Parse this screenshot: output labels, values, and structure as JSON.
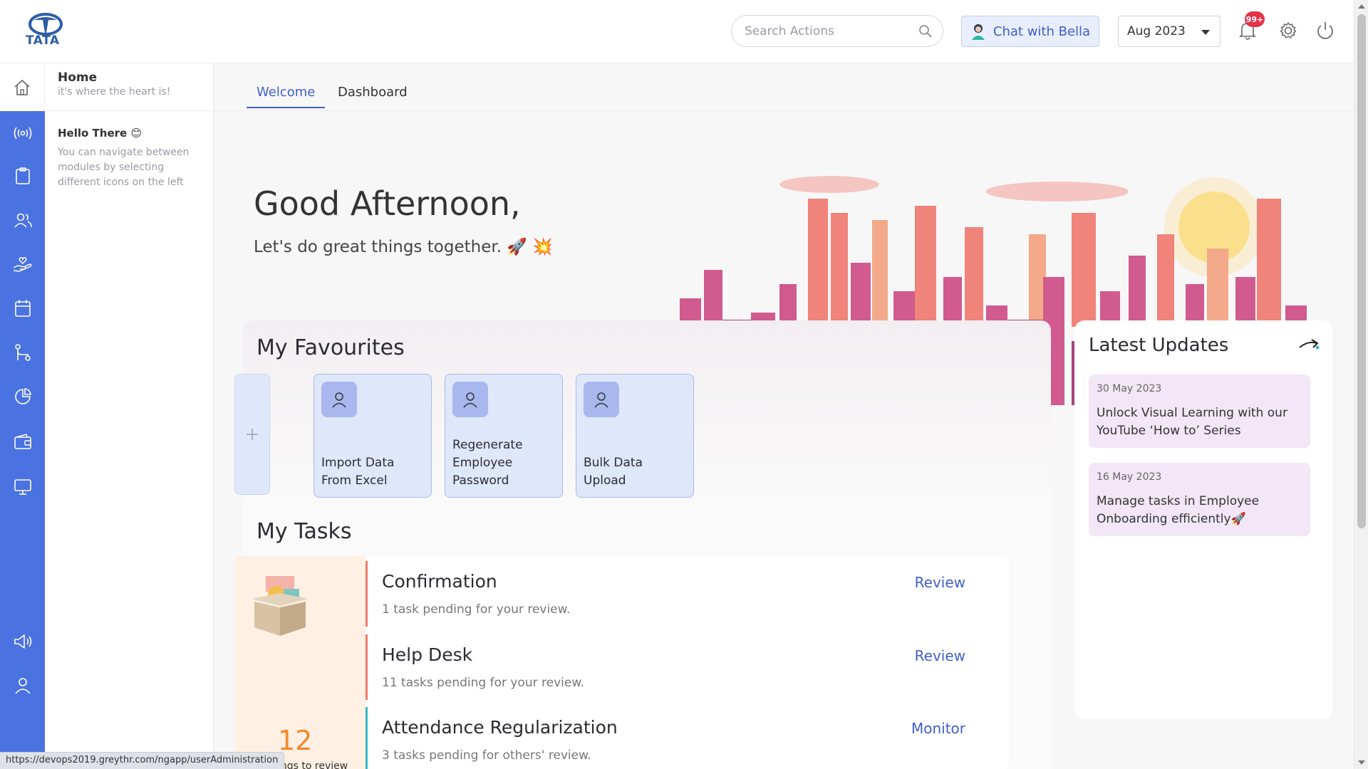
{
  "brand": {
    "logo_text": "TATA"
  },
  "header": {
    "search_placeholder": "Search Actions",
    "chat_label": "Chat with Bella",
    "month": "Aug 2023",
    "notification_badge": "99+"
  },
  "rail": {
    "icons": [
      "home-icon",
      "broadcast-icon",
      "clipboard-icon",
      "people-icon",
      "hand-heart-icon",
      "calendar-icon",
      "workflow-icon",
      "pie-chart-icon",
      "wallet-icon",
      "monitor-icon",
      "megaphone-icon",
      "user-icon"
    ]
  },
  "subnav": {
    "title": "Home",
    "subtitle": "it's where the heart is!",
    "hello": "Hello There",
    "hello_emoji": "😊",
    "description": "You can navigate between modules by selecting different icons on the left"
  },
  "tabs": [
    {
      "label": "Welcome",
      "active": true
    },
    {
      "label": "Dashboard",
      "active": false
    }
  ],
  "welcome": {
    "greeting": "Good Afternoon,",
    "tagline": "Let's do great things together. 🚀 💥"
  },
  "favourites": {
    "title": "My Favourites",
    "items": [
      {
        "label": "Import Data From Excel"
      },
      {
        "label": "Regenerate Employee Password"
      },
      {
        "label": "Bulk Data Upload"
      }
    ]
  },
  "tasks": {
    "title": "My Tasks",
    "count": "12",
    "count_label": "ings to review",
    "items": [
      {
        "title": "Confirmation",
        "desc": "1 task pending for your review.",
        "action": "Review",
        "color": "#f07a6a"
      },
      {
        "title": "Help Desk",
        "desc": "11 tasks pending for your review.",
        "action": "Review",
        "color": "#f07a6a"
      },
      {
        "title": "Attendance Regularization",
        "desc": "3 tasks pending for others' review.",
        "action": "Monitor",
        "color": "#38b6c4"
      }
    ]
  },
  "updates": {
    "title": "Latest Updates",
    "items": [
      {
        "date": "30 May 2023",
        "text": "Unlock Visual Learning with our YouTube ‘How to’ Series"
      },
      {
        "date": "16 May 2023",
        "text": "Manage tasks in Employee Onboarding efficiently🚀"
      }
    ]
  },
  "status_url": "https://devops2019.greythr.com/ngapp/userAdministration",
  "colors": {
    "accent": "#3f5fc8",
    "rail": "#4a72e0",
    "badge": "#e3344a"
  }
}
